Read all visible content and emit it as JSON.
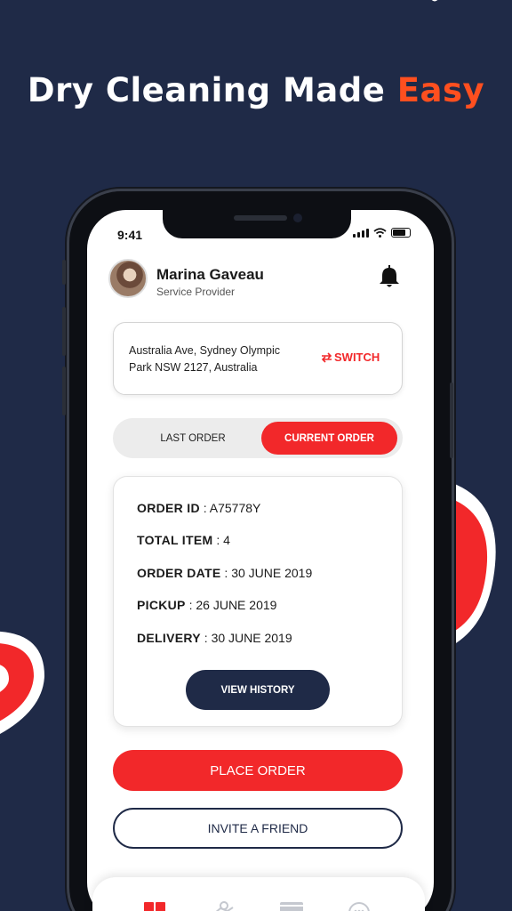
{
  "headline": {
    "main": "Dry Cleaning Made ",
    "accent": "Easy"
  },
  "colors": {
    "background": "#1f2a47",
    "accent": "#f2282a",
    "headline_accent": "#ff4f1f",
    "dark": "#1f2a47"
  },
  "status_bar": {
    "time": "9:41"
  },
  "profile": {
    "name": "Marina Gaveau",
    "role": "Service Provider",
    "notification_icon": "bell-icon"
  },
  "address": {
    "line1": "Australia Ave, Sydney Olympic",
    "line2": "Park NSW 2127, Australia",
    "switch_label": "SWITCH",
    "switch_icon": "swap-arrows-icon"
  },
  "tabs": [
    {
      "label": "LAST ORDER",
      "active": false
    },
    {
      "label": "CURRENT ORDER",
      "active": true
    }
  ],
  "order": {
    "rows": [
      {
        "label": "ORDER ID",
        "sep": " : ",
        "value": "A75778Y"
      },
      {
        "label": "TOTAL ITEM",
        "sep": " : ",
        "value": "4"
      },
      {
        "label": "ORDER DATE",
        "sep": " : ",
        "value": "30 JUNE 2019"
      },
      {
        "label": "PICKUP",
        "sep": " : ",
        "value": "26 JUNE 2019"
      },
      {
        "label": "DELIVERY",
        "sep": " : ",
        "value": "30 JUNE 2019"
      }
    ],
    "view_history_label": "VIEW HISTORY"
  },
  "actions": {
    "place_order_label": "PLACE ORDER",
    "invite_label": "INVITE A FRIEND"
  },
  "bottom_nav": {
    "items": [
      "dashboard-icon",
      "map-pin-icon",
      "card-icon",
      "chat-icon"
    ]
  }
}
